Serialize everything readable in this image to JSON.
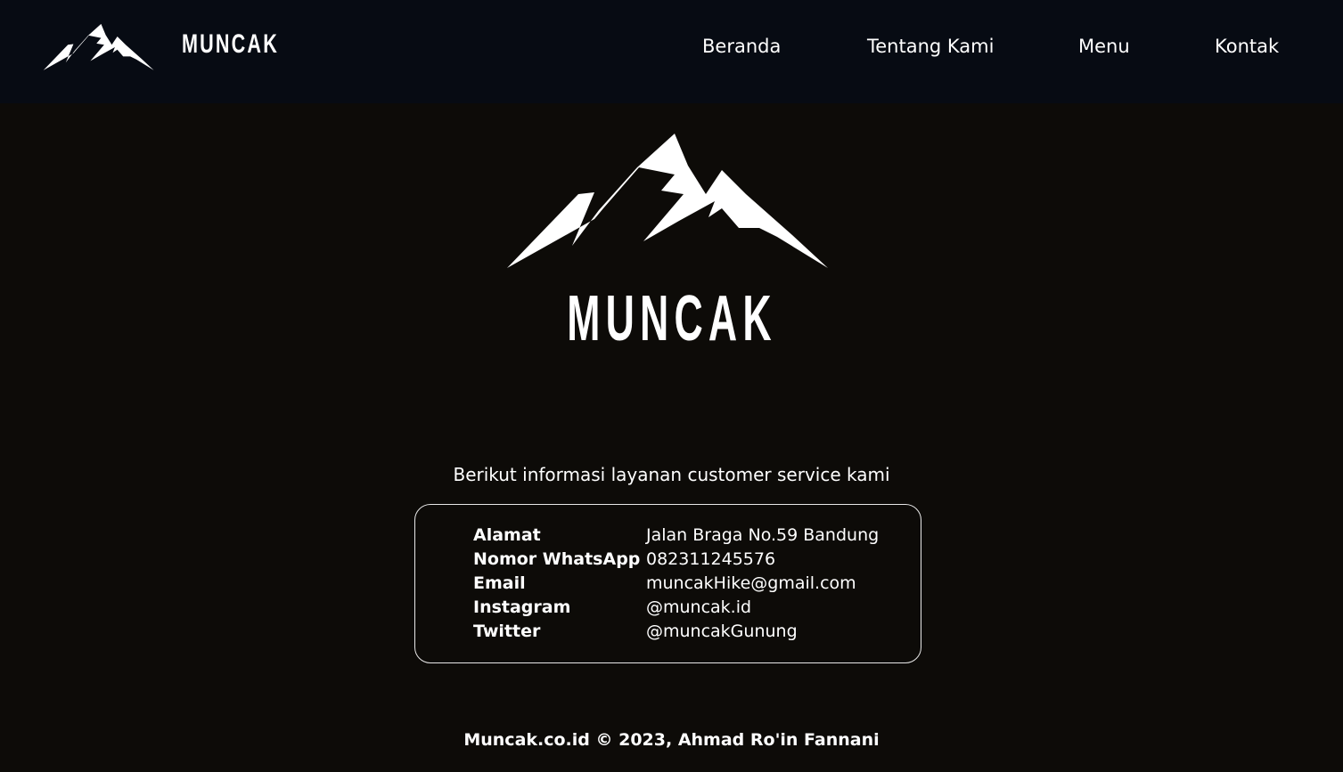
{
  "brand": {
    "name": "MUNCAK",
    "logo_icon": "mountain-icon"
  },
  "nav": {
    "items": [
      {
        "label": "Beranda"
      },
      {
        "label": "Tentang Kami"
      },
      {
        "label": "Menu"
      },
      {
        "label": "Kontak"
      }
    ]
  },
  "hero": {
    "wordmark": "MUNCAK"
  },
  "contact": {
    "intro": "Berikut informasi layanan customer service kami",
    "rows": [
      {
        "label": "Alamat",
        "value": "Jalan Braga No.59 Bandung"
      },
      {
        "label": "Nomor WhatsApp",
        "value": "082311245576"
      },
      {
        "label": "Email",
        "value": "muncakHike@gmail.com"
      },
      {
        "label": "Instagram",
        "value": "@muncak.id"
      },
      {
        "label": "Twitter",
        "value": "@muncakGunung"
      }
    ]
  },
  "footer": {
    "text": "Muncak.co.id © 2023, Ahmad Ro'in Fannani"
  },
  "colors": {
    "navbar_bg": "#070b13",
    "page_bg": "#0d0b08",
    "text": "#ffffff",
    "card_border": "#e8e8e8"
  }
}
